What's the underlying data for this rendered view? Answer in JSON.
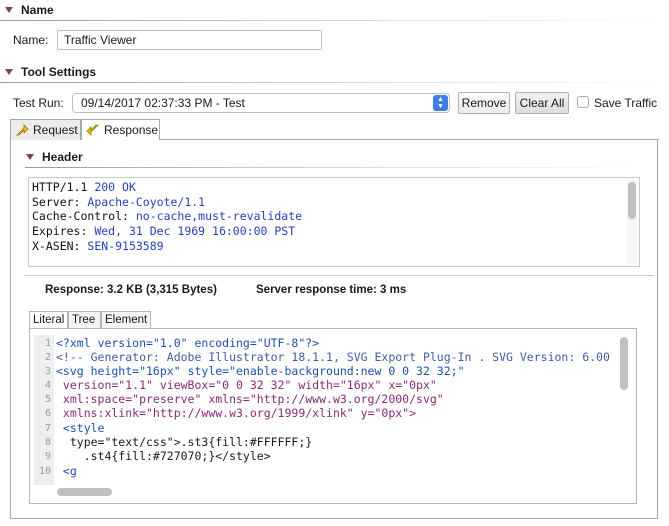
{
  "name_section": {
    "title": "Name",
    "label": "Name:",
    "value": "Traffic Viewer"
  },
  "tool_settings": {
    "title": "Tool Settings",
    "test_run_label": "Test Run:",
    "test_run_value": "09/14/2017 02:37:33 PM - Test",
    "remove_label": "Remove",
    "clear_all_label": "Clear All",
    "save_traffic_label": "Save Traffic",
    "save_traffic_checked": false
  },
  "tabs": [
    {
      "label": "Request",
      "active": false
    },
    {
      "label": "Response",
      "active": true
    }
  ],
  "header_section": {
    "title": "Header",
    "lines": [
      {
        "key": "HTTP/1.1",
        "value": "200 OK"
      },
      {
        "key": "Server:",
        "value": "Apache-Coyote/1.1"
      },
      {
        "key": "Cache-Control:",
        "value": "no-cache,must-revalidate"
      },
      {
        "key": "Expires:",
        "value": "Wed, 31 Dec 1969 16:00:00 PST"
      },
      {
        "key": "X-ASEN:",
        "value": "SEN-9153589"
      }
    ]
  },
  "response_info": {
    "size": "Response: 3.2 KB (3,315 Bytes)",
    "time": "Server response time: 3 ms"
  },
  "view_tabs": [
    {
      "label": "Literal",
      "active": true
    },
    {
      "label": "Tree",
      "active": false
    },
    {
      "label": "Element",
      "active": false
    }
  ],
  "code": {
    "line_numbers": [
      "1",
      "2",
      "3",
      "4",
      "5",
      "6",
      "7",
      "8",
      "9",
      "10"
    ],
    "lines": [
      "<?xml version=\"1.0\" encoding=\"UTF-8\"?>",
      "<!-- Generator: Adobe Illustrator 18.1.1, SVG Export Plug-In . SVG Version: 6.00",
      "<svg height=\"16px\" style=\"enable-background:new 0 0 32 32;\"",
      " version=\"1.1\" viewBox=\"0 0 32 32\" width=\"16px\" x=\"0px\"",
      " xml:space=\"preserve\" xmlns=\"http://www.w3.org/2000/svg\"",
      " xmlns:xlink=\"http://www.w3.org/1999/xlink\" y=\"0px\">",
      " <style",
      "  type=\"text/css\">.st3{fill:#FFFFFF;}",
      "    .st4{fill:#727070;}</style>",
      " <g"
    ]
  },
  "icons": {
    "section_toggle": "triangle-down-icon",
    "select_stepper": "stepper-icon",
    "request_tab": "request-arrow-icon",
    "response_tab": "response-arrow-icon"
  },
  "colors": {
    "accent": "#3d7fe0",
    "header_value": "#2642b8"
  }
}
